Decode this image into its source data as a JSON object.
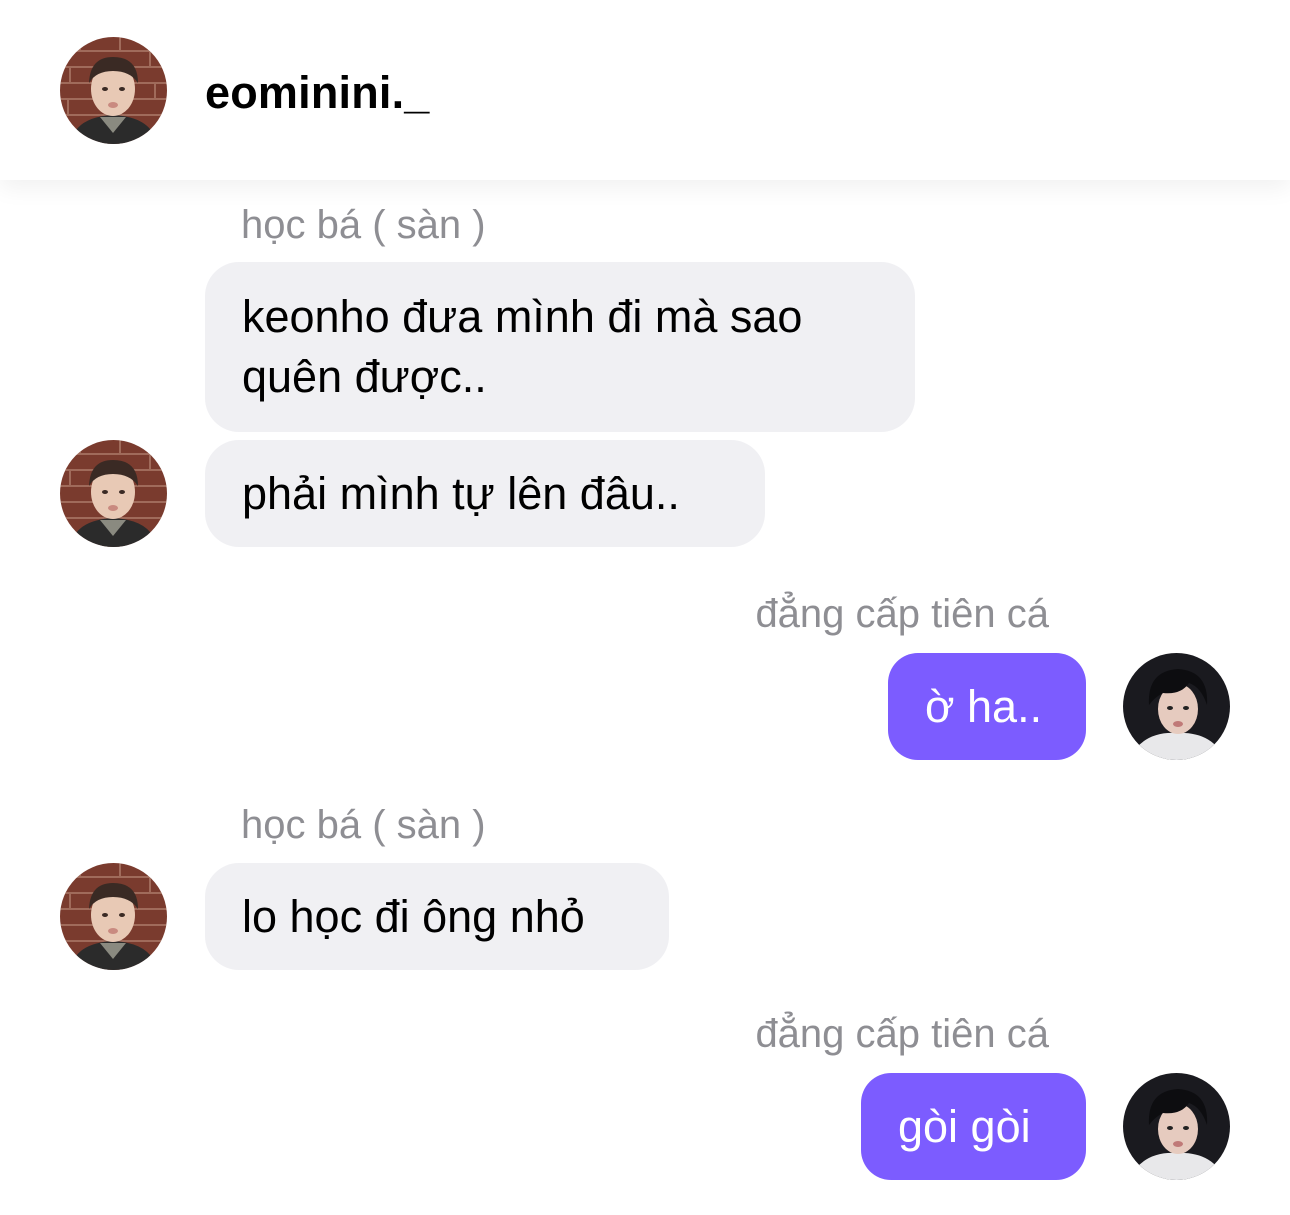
{
  "header": {
    "title": "eominini._",
    "avatar_icon": "profile-photo-eominini"
  },
  "colors": {
    "incoming_bubble": "#f0f0f3",
    "outgoing_bubble": "#7c5cff",
    "sender_label": "#8e8e93"
  },
  "messages": [
    {
      "sender": "học bá ( sàn )",
      "direction": "incoming",
      "lines": [
        "keonho đưa mình đi mà sao",
        "quên được.."
      ]
    },
    {
      "direction": "incoming",
      "lines": [
        "phải mình tự lên đâu.."
      ]
    },
    {
      "sender": "đẳng cấp tiên cá",
      "direction": "outgoing",
      "lines": [
        "ờ ha.."
      ]
    },
    {
      "sender": "học bá ( sàn )",
      "direction": "incoming",
      "lines": [
        "lo học đi ông nhỏ"
      ]
    },
    {
      "sender": "đẳng cấp tiên cá",
      "direction": "outgoing",
      "lines": [
        "gòi gòi"
      ]
    }
  ]
}
